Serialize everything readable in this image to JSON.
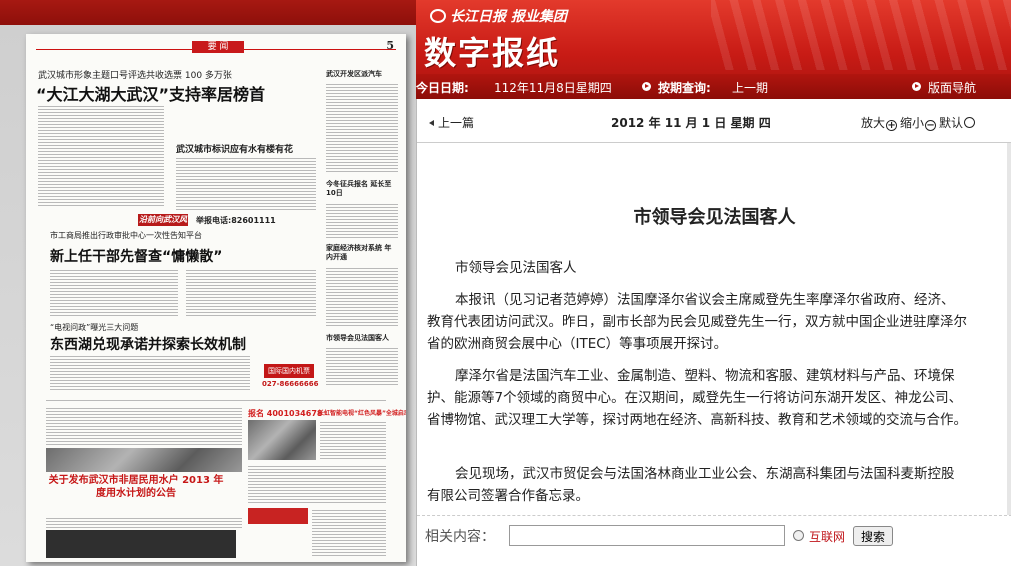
{
  "header": {
    "brand": "长江日报 报业集团",
    "title": "数字报纸",
    "today_label": "今日日期:",
    "today_value": "112年11月8日星期四",
    "query_label": "按期查询:",
    "query_value": "上一期",
    "nav_label": "版面导航"
  },
  "toolbar": {
    "prev_label": "上一篇",
    "date": "2012 年 11 月 1 日   星期 四",
    "zoom_in": "放大",
    "zoom_out": "缩小",
    "default": "默认"
  },
  "article": {
    "title": "市领导会见法国客人",
    "paragraphs": [
      "市领导会见法国客人",
      "本报讯（见习记者范婷婷）法国摩泽尔省议会主席威登先生率摩泽尔省政府、经济、教育代表团访问武汉。昨日，副市长部为民会见威登先生一行，双方就中国企业进驻摩泽尔省的欧洲商贸会展中心（ITEC）等事项展开探讨。",
      "摩泽尔省是法国汽车工业、金属制造、塑料、物流和客服、建筑材料与产品、环境保护、能源等7个领域的商贸中心。在汉期间，威登先生一行将访问东湖开发区、神龙公司、省博物馆、武汉理工大学等，探讨两地在经济、高新科技、教育和艺术领域的交流与合作。",
      "会见现场，武汉市贸促会与法国洛林商业工业公会、东湖高科集团与法国科麦斯控股有限公司签署合作备忘录。"
    ]
  },
  "related": {
    "label": "相关内容：",
    "input_value": "",
    "radio_label": "互联网",
    "search_button": "搜索"
  },
  "newspaper": {
    "section": "要 闻",
    "page_number": "5",
    "sub1": "武汉城市形象主题口号评选共收选票 100 多万张",
    "head1": "“大江大湖大武汉”支持率居榜首",
    "rhead": "武汉城市标识应有水有楼有花",
    "banner": "沿前向武汉风景",
    "tel": "举报电话:82601111",
    "sub2": "市工商局推出行政审批中心一次性告知平台",
    "head2": "新上任干部先督查“慵懒散”",
    "sub3": "“电视问政”曝光三大问题",
    "head3": "东西湖兑现承诺并探索长效机制",
    "rc1": "武汉开发区派汽车",
    "rc2": "今冬征兵报名 延长至10日",
    "rc3": "家庭经济核对系统 年内开通",
    "rc4": "市领导会见法国客人",
    "hotline": "国际国内机票",
    "hotnum": "027-86666666",
    "ad1": "报名 4001034678",
    "ad2": "长虹智能电视“红色风暴”全城启动",
    "notice": "关于发布武汉市非居民用水户 2013 年度用水计划的公告"
  }
}
